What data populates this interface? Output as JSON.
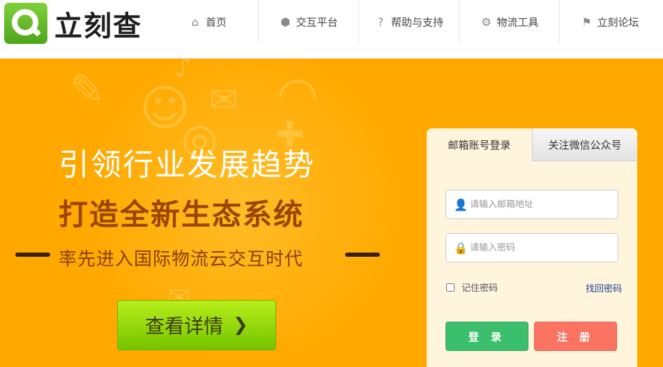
{
  "logo": {
    "text": "立刻查"
  },
  "nav": [
    {
      "icon": "home-icon",
      "label": "首页"
    },
    {
      "icon": "cube-icon",
      "label": "交互平台"
    },
    {
      "icon": "question-icon",
      "label": "帮助与支持"
    },
    {
      "icon": "gear-icon",
      "label": "物流工具"
    },
    {
      "icon": "bookmark-icon",
      "label": "立刻论坛"
    }
  ],
  "hero": {
    "line1": "引领行业发展趋势",
    "line2": "打造全新生态系统",
    "line3": "率先进入国际物流云交互时代",
    "cta_label": "查看详情"
  },
  "login": {
    "tabs": [
      "邮箱账号登录",
      "关注微信公众号"
    ],
    "email_placeholder": "请输入邮箱地址",
    "password_placeholder": "请输入密码",
    "remember_label": "记住密码",
    "forgot_label": "找回密码",
    "login_button": "登 录",
    "register_button": "注 册"
  },
  "colors": {
    "hero_bg": "#ffa900",
    "cta": "#8fd60a",
    "login_button": "#3cbf6c",
    "register_button": "#fb7361",
    "panel_bg": "#fff5dd"
  }
}
